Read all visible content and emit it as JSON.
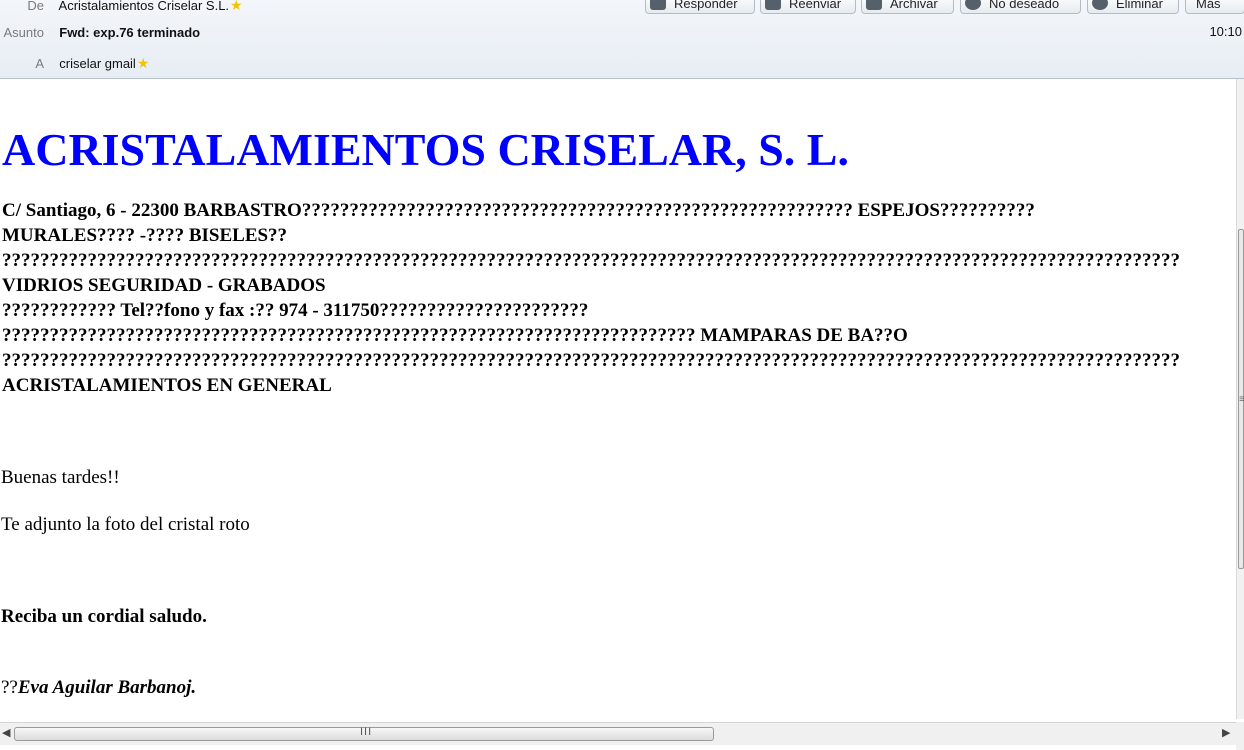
{
  "header": {
    "from_label": "De",
    "from_value": "Acristalamientos Criselar S.L.",
    "subject_label": "Asunto",
    "subject_value": "Fwd: exp.76 terminado",
    "to_label": "A",
    "to_value": "criselar gmail",
    "time": "10:10",
    "star_icon": "star-icon",
    "star_color": "#f2c400"
  },
  "toolbar": {
    "buttons": [
      {
        "label": "Responder",
        "icon": "reply-icon"
      },
      {
        "label": "Reenviar",
        "icon": "forward-icon"
      },
      {
        "label": "Archivar",
        "icon": "archive-icon"
      },
      {
        "label": "No deseado",
        "icon": "junk-icon"
      },
      {
        "label": "Eliminar",
        "icon": "delete-icon"
      },
      {
        "label": "Más",
        "icon": "more-icon"
      }
    ]
  },
  "message": {
    "company": "ACRISTALAMIENTOS CRISELAR, S. L.",
    "company_color": "#0000ff",
    "address_lines": [
      "C/ Santiago, 6 - 22300 BARBASTRO?????????????????????????????????????????????????????????? ESPEJOS??????????",
      "MURALES???? -???? BISELES??",
      "????????????????????????????????????????????????????????????????????????????????????????????????????????????????????????????",
      "VIDRIOS SEGURIDAD - GRABADOS",
      "???????????? Tel??fono y fax :?? 974 - 311750??????????????????????",
      "????????????????????????????????????????????????????????????????????????? MAMPARAS DE BA??O",
      "????????????????????????????????????????????????????????????????????????????????????????????????????????????????????????????",
      "ACRISTALAMIENTOS EN GENERAL"
    ],
    "greeting": "Buenas tardes!!",
    "body_line": "Te adjunto la foto del cristal roto",
    "closing": "Reciba un cordial saludo.",
    "signature_prefix": "??",
    "signature_name": "Eva Aguilar Barbanoj."
  },
  "scrollbars": {
    "horizontal_grip": "III",
    "vertical_grip": "≡"
  }
}
